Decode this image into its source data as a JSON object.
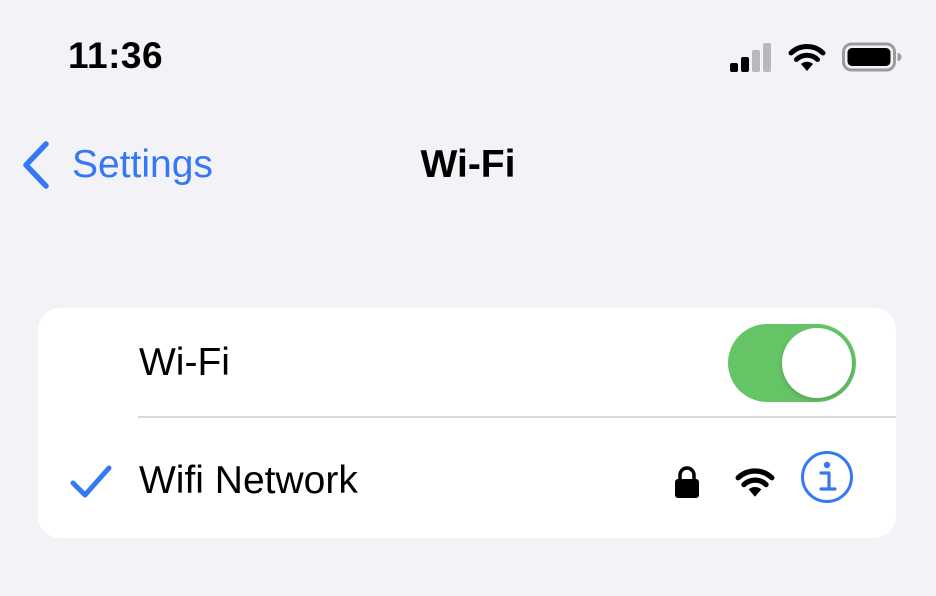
{
  "status_bar": {
    "time": "11:36",
    "icons": [
      "cellular-signal-icon",
      "wifi-icon",
      "battery-icon"
    ]
  },
  "nav": {
    "back_label": "Settings",
    "title": "Wi-Fi"
  },
  "wifi_row": {
    "label": "Wi-Fi",
    "toggle_on": true
  },
  "network_row": {
    "name": "Wifi Network",
    "connected": true,
    "secured": true,
    "icons": [
      "checkmark-icon",
      "lock-icon",
      "wifi-signal-icon",
      "info-icon"
    ]
  },
  "colors": {
    "background": "#f2f2f7",
    "accent": "#3478f6",
    "toggle_on": "#65c466",
    "card": "#ffffff"
  }
}
